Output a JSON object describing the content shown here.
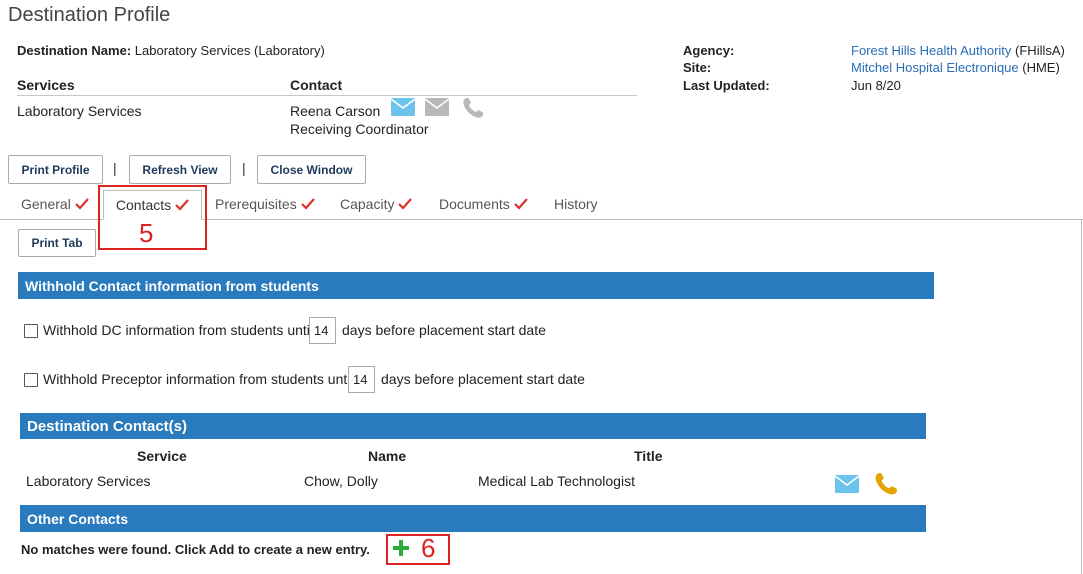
{
  "page": {
    "title": "Destination Profile"
  },
  "header": {
    "dest_name_label": "Destination Name",
    "dest_name_sep": ":",
    "dest_name_value": "Laboratory Services (Laboratory)",
    "services_label": "Services",
    "contact_label": "Contact",
    "service_value": "Laboratory Services",
    "contact_name": "Reena Carson",
    "contact_title": "Receiving Coordinator",
    "agency_label": "Agency",
    "agency_colon": ":",
    "agency_link": "Forest Hills Health Authority",
    "agency_code": "(FHillsA)",
    "site_label": "Site",
    "site_colon": ":",
    "site_link": "Mitchel Hospital Electronique",
    "site_code": "(HME)",
    "updated_label": "Last Updated",
    "updated_colon": ":",
    "updated_value": "Jun 8/20"
  },
  "toolbar": {
    "print_profile": "Print Profile",
    "refresh_view": "Refresh View",
    "close_window": "Close Window",
    "separator": "|"
  },
  "tabs": [
    {
      "label": "General",
      "checked": true
    },
    {
      "label": "Contacts",
      "checked": true,
      "active": true
    },
    {
      "label": "Prerequisites",
      "checked": true
    },
    {
      "label": "Capacity",
      "checked": true
    },
    {
      "label": "Documents",
      "checked": true
    },
    {
      "label": "History",
      "checked": false
    }
  ],
  "contacts_tab": {
    "print_tab": "Print Tab",
    "withhold_header": "Withhold Contact information from students",
    "dc_label": "Withhold DC information from students until",
    "dc_days": "14",
    "dc_suffix": "days before placement start date",
    "preceptor_label": "Withhold Preceptor information from students until",
    "preceptor_days": "14",
    "preceptor_suffix": "days before placement start date",
    "dest_contacts_header": "Destination Contact(s)",
    "columns": {
      "service": "Service",
      "name": "Name",
      "title": "Title"
    },
    "rows": [
      {
        "service": "Laboratory Services",
        "name": "Chow, Dolly",
        "title": "Medical Lab Technologist"
      }
    ],
    "other_contacts_header": "Other Contacts",
    "no_matches": "No matches were found. Click Add to create a new entry."
  },
  "annotations": {
    "label_5": "5",
    "label_6": "6"
  },
  "icons": {
    "email": "envelope-icon",
    "email_disabled": "envelope-icon",
    "phone_disabled": "phone-icon",
    "phone": "phone-icon",
    "add": "plus-icon",
    "check": "checkmark-icon"
  },
  "colors": {
    "header_bar": "#2a7bbd",
    "link": "#2a6db5",
    "check": "#d9342b",
    "email": "#6cc4ec",
    "phone": "#e5a500",
    "add": "#2eaa3c",
    "annotation": "#dd2222",
    "disabled_icon": "#b8b8b8"
  }
}
